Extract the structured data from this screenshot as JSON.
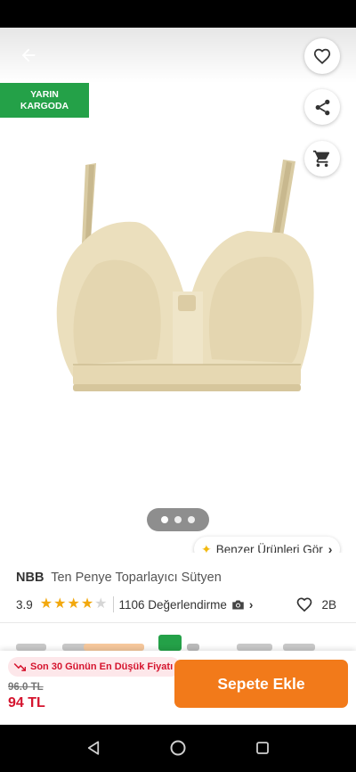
{
  "badge": {
    "line1": "YARIN",
    "line2": "KARGODA"
  },
  "gallery": {
    "page_count": 3,
    "current_page": 1
  },
  "similar": {
    "label": "Benzer Ürünleri Gör",
    "icon": "sparkle-icon"
  },
  "product": {
    "brand": "NBB",
    "name": "Ten Penye Toparlayıcı Sütyen"
  },
  "rating": {
    "value": "3.9",
    "stars": 4,
    "max_stars": 5,
    "reviews": "1106 Değerlendirme",
    "review_icon": "camera-icon"
  },
  "likes": {
    "count": "2B",
    "icon": "heart-outline-icon"
  },
  "price": {
    "lowest_label": "Son 30 Günün En Düşük Fiyatı",
    "old": "96.0 TL",
    "new": "94 TL"
  },
  "actions": {
    "add_to_cart": "Sepete Ekle"
  },
  "colors": {
    "brand_orange": "#f27a1a",
    "cargo_green": "#24a148",
    "price_red": "#d5142e",
    "star": "#f2a80d"
  }
}
